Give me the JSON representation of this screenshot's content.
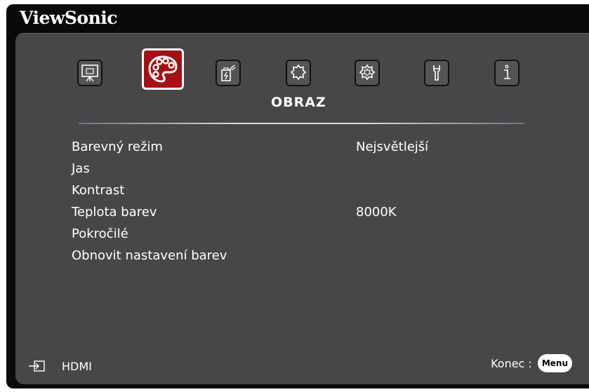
{
  "brand": "ViewSonic",
  "tabs": [
    {
      "icon": "display-icon",
      "active": false
    },
    {
      "icon": "palette-icon",
      "active": true
    },
    {
      "icon": "power-management-icon",
      "active": false
    },
    {
      "icon": "basic-settings-icon",
      "active": false
    },
    {
      "icon": "advanced-settings-icon",
      "active": false
    },
    {
      "icon": "wrench-icon",
      "active": false
    },
    {
      "icon": "info-icon",
      "active": false
    }
  ],
  "section_title": "OBRAZ",
  "menu": [
    {
      "label": "Barevný režim",
      "value": "Nejsvětlejší"
    },
    {
      "label": "Jas",
      "value": ""
    },
    {
      "label": "Kontrast",
      "value": ""
    },
    {
      "label": "Teplota barev",
      "value": "8000K"
    },
    {
      "label": "Pokročilé",
      "value": ""
    },
    {
      "label": "Obnovit nastavení barev",
      "value": ""
    }
  ],
  "footer": {
    "source_icon": "input-source-icon",
    "source": "HDMI",
    "exit_label": "Konec :",
    "exit_key": "Menu"
  },
  "colors": {
    "accent": "#a50f16",
    "panel": "#474747",
    "frame": "#0a0a0a"
  }
}
